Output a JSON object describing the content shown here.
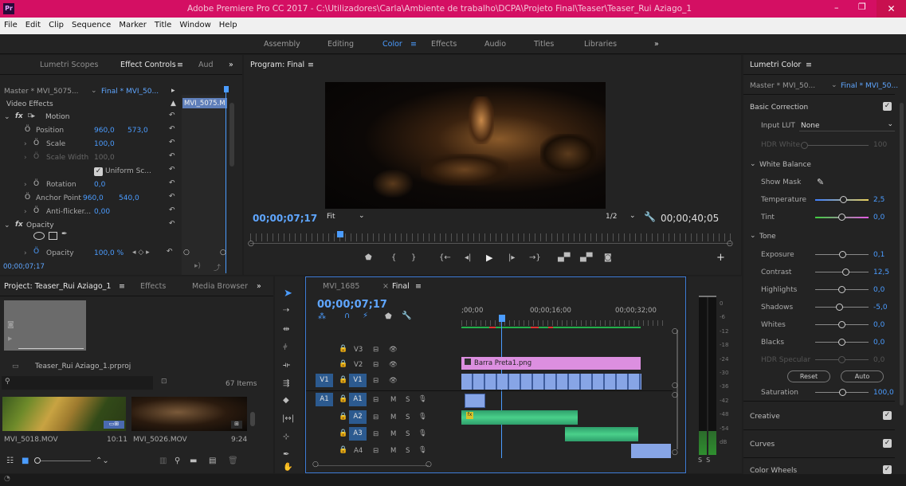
{
  "window": {
    "title": "Adobe Premiere Pro CC 2017 - C:\\Utilizadores\\Carla\\Ambiente de trabalho\\DCPA\\Projeto Final\\Teaser\\Teaser_Rui Aziago_1",
    "app_badge": "Pr"
  },
  "menu": [
    "File",
    "Edit",
    "Clip",
    "Sequence",
    "Marker",
    "Title",
    "Window",
    "Help"
  ],
  "workspaces": [
    "Assembly",
    "Editing",
    "Color",
    "Effects",
    "Audio",
    "Titles",
    "Libraries",
    "»"
  ],
  "left_top": {
    "tabs": [
      "Lumetri Scopes",
      "Effect Controls",
      "Aud",
      "»"
    ],
    "master": "Master * MVI_5075...",
    "seq": "Final * MVI_50...",
    "clip_label": "MVI_5075.M",
    "video_effects": "Video Effects",
    "rows": [
      {
        "name": "Motion"
      },
      {
        "name": "Position",
        "v1": "960,0",
        "v2": "573,0"
      },
      {
        "name": "Scale",
        "v1": "100,0"
      },
      {
        "name": "Scale Width",
        "v1": "100,0"
      },
      {
        "name": "Uniform Sc..."
      },
      {
        "name": "Rotation",
        "v1": "0,0"
      },
      {
        "name": "Anchor Point",
        "v1": "960,0",
        "v2": "540,0"
      },
      {
        "name": "Anti-flicker...",
        "v1": "0,00"
      },
      {
        "name": "Opacity"
      },
      {
        "name": "Opacity",
        "v1": "100,0 %"
      }
    ],
    "time": "00;00;07;17"
  },
  "program": {
    "tab": "Program: Final",
    "timecode": "00;00;07;17",
    "fit": "Fit",
    "res": "1/2",
    "duration": "00;00;40;05"
  },
  "lumetri": {
    "tab": "Lumetri Color",
    "master": "Master * MVI_50...",
    "seq": "Final * MVI_50...",
    "basic": "Basic Correction",
    "input_lut": "Input LUT",
    "lut_val": "None",
    "hdr_white": "HDR White",
    "hdr_white_val": "100",
    "wb": "White Balance",
    "show_mask": "Show Mask",
    "temperature": "Temperature",
    "temperature_val": "2,5",
    "tint": "Tint",
    "tint_val": "0,0",
    "tone": "Tone",
    "exposure": "Exposure",
    "exposure_val": "0,1",
    "contrast": "Contrast",
    "contrast_val": "12,5",
    "highlights": "Highlights",
    "highlights_val": "0,0",
    "shadows": "Shadows",
    "shadows_val": "-5,0",
    "whites": "Whites",
    "whites_val": "0,0",
    "blacks": "Blacks",
    "blacks_val": "0,0",
    "hdr_spec": "HDR Specular",
    "hdr_spec_val": "0,0",
    "reset": "Reset",
    "auto": "Auto",
    "saturation": "Saturation",
    "saturation_val": "100,0",
    "creative": "Creative",
    "curves": "Curves",
    "wheels": "Color Wheels"
  },
  "project": {
    "tabs": [
      "Project: Teaser_Rui Aziago_1",
      "Effects",
      "Media Browser",
      "»"
    ],
    "file": "Teaser_Rui Aziago_1.prproj",
    "items": "67 Items",
    "clip1": "MVI_5018.MOV",
    "clip1_dur": "10:11",
    "clip2": "MVI_5026.MOV",
    "clip2_dur": "9:24"
  },
  "timeline": {
    "tabs": [
      "MVI_1685",
      "Final"
    ],
    "timecode": "00;00;07;17",
    "ruler": [
      ";00;00",
      "00;00;16;00",
      "00;00;32;00"
    ],
    "tracks": [
      {
        "id": "V3",
        "src": ""
      },
      {
        "id": "V2",
        "src": ""
      },
      {
        "id": "V1",
        "src": "V1"
      },
      {
        "id": "A1",
        "src": "A1"
      },
      {
        "id": "A2",
        "src": ""
      },
      {
        "id": "A3",
        "src": ""
      },
      {
        "id": "A4",
        "src": ""
      }
    ],
    "clip_v2": "Barra Preta1.png",
    "meter_scale": [
      "0",
      "-6",
      "-12",
      "-18",
      "-24",
      "-30",
      "-36",
      "-42",
      "-48",
      "-54",
      "dB"
    ],
    "ss": "S  S"
  }
}
